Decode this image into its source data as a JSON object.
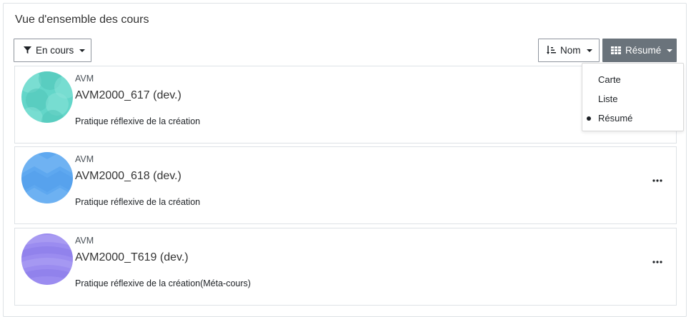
{
  "block": {
    "title": "Vue d'ensemble des cours"
  },
  "controls": {
    "filter_label": "En cours",
    "sort_label": "Nom",
    "view_label": "Résumé"
  },
  "view_menu": {
    "items": [
      {
        "label": "Carte",
        "selected": false
      },
      {
        "label": "Liste",
        "selected": false
      },
      {
        "label": "Résumé",
        "selected": true
      }
    ]
  },
  "courses": [
    {
      "category": "AVM",
      "name": "AVM2000_617 (dev.)",
      "summary": "Pratique réflexive de la création",
      "color": "#63d6c9"
    },
    {
      "category": "AVM",
      "name": "AVM2000_618 (dev.)",
      "summary": "Pratique réflexive de la création",
      "color": "#5ea8f0"
    },
    {
      "category": "AVM",
      "name": "AVM2000_T619 (dev.)",
      "summary": "Pratique réflexive de la création(Méta-cours)",
      "color": "#9b8cf0"
    }
  ],
  "colors": {
    "view_button_bg": "#6a737b",
    "border": "#dee2e6"
  }
}
